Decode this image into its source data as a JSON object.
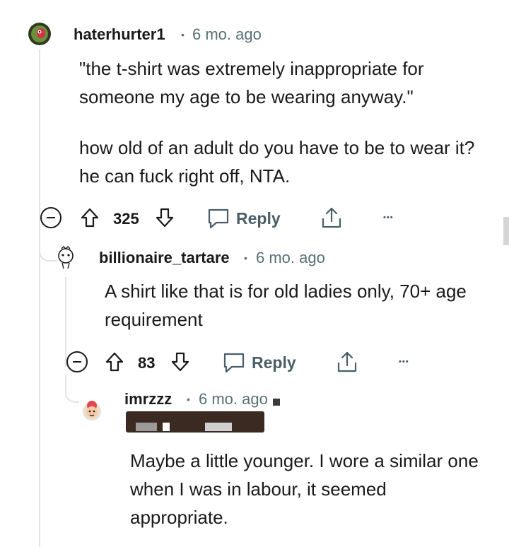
{
  "comments": [
    {
      "username": "haterhurter1",
      "time": "6 mo. ago",
      "paragraphs": [
        "\"the t-shirt was extremely inappropriate for someone my age to be wearing anyway.\"",
        "how old of an adult do you have to be to wear it? he can fuck right off, NTA."
      ],
      "votes": "325",
      "reply_label": "Reply",
      "more_label": "•••"
    },
    {
      "username": "billionaire_tartare",
      "time": "6 mo. ago",
      "text": "A shirt like that is for old ladies only, 70+ age requirement",
      "votes": "83",
      "reply_label": "Reply",
      "more_label": "•••"
    },
    {
      "username": "imrzzz",
      "time": "6 mo. ago",
      "text": "Maybe a little younger. I wore a similar one when I was in labour, it seemed appropriate."
    }
  ],
  "separator": "•",
  "icons": {
    "collapse": "collapse-icon",
    "upvote": "upvote-arrow-icon",
    "downvote": "downvote-arrow-icon",
    "reply": "chat-bubble-icon",
    "share": "share-icon",
    "more": "more-options-icon"
  },
  "colors": {
    "text": "#1a1a1b",
    "meta": "#576f76",
    "icon": "#4a5d68",
    "thread_line": "#e0e4e6"
  }
}
